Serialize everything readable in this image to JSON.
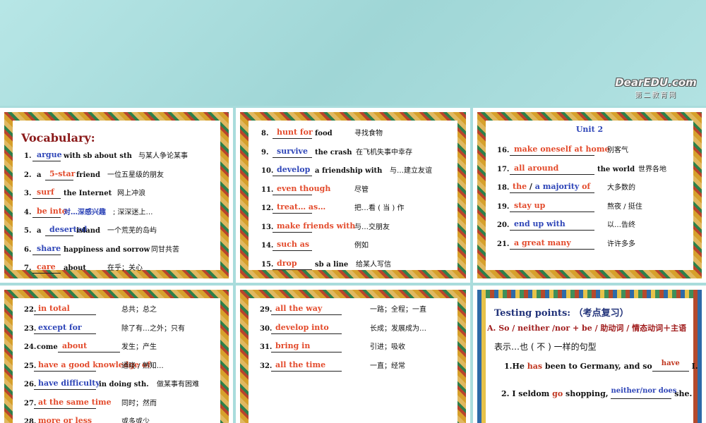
{
  "watermark": {
    "line1": "DearEDU.com",
    "line2": "第二教育网"
  },
  "vocab_title": "Vocabulary:",
  "slide2_unit": "Unit 2",
  "slide1_items": [
    {
      "num": "1.",
      "pre": "",
      "ans": "argue",
      "color": "blue",
      "post": "with sb about sth",
      "cn": "与某人争论某事"
    },
    {
      "num": "2.",
      "pre": "a",
      "ans": "5-star",
      "color": "red",
      "post": "friend",
      "cn": "一位五星级的朋友"
    },
    {
      "num": "3.",
      "pre": "",
      "ans": "surf",
      "color": "red",
      "post": "the Internet",
      "cn": "网上冲浪"
    },
    {
      "num": "4.",
      "pre": "",
      "ans": "be into",
      "color": "red",
      "post": "对…深感兴趣",
      "cn": "; 深深迷上…"
    },
    {
      "num": "5.",
      "pre": "a",
      "ans": "deserted",
      "color": "blue",
      "post": "island",
      "cn": "一个荒芜的岛屿"
    },
    {
      "num": "6.",
      "pre": "",
      "ans": "share",
      "color": "blue",
      "post": "happiness and sorrow",
      "cn": "同甘共苦"
    },
    {
      "num": "7.",
      "pre": "",
      "ans": "care",
      "color": "red",
      "post": "about",
      "cn": "在乎；关心"
    }
  ],
  "slide_mid_items": [
    {
      "num": "8.",
      "ans": "hunt for",
      "color": "red",
      "post": "food",
      "cn": "寻找食物"
    },
    {
      "num": "9.",
      "ans": "survive",
      "color": "blue",
      "post": "the crash",
      "cn": "在飞机失事中幸存"
    },
    {
      "num": "10.",
      "ans": "develop",
      "color": "blue",
      "post": "a friendship with",
      "cn": "与…建立友谊"
    },
    {
      "num": "11.",
      "ans": "even though",
      "color": "red",
      "post": "",
      "cn": "尽管"
    },
    {
      "num": "12.",
      "ans": "treat… as…",
      "color": "red",
      "post": "",
      "cn": "把…看 ( 当 ) 作"
    },
    {
      "num": "13.",
      "ans": "make friends with",
      "color": "red",
      "post": "",
      "cn": "与…交朋友"
    },
    {
      "num": "14.",
      "ans": "such as",
      "color": "red",
      "post": "",
      "cn": "例如"
    },
    {
      "num": "15.",
      "ans": "drop",
      "color": "red",
      "post": "sb a line",
      "cn": "给某人写信"
    }
  ],
  "slide_right_items": [
    {
      "num": "16.",
      "ans": "make oneself at home",
      "color": "red",
      "post": "",
      "cn": "别客气"
    },
    {
      "num": "17.",
      "ans": "all around",
      "color": "red",
      "post": "the world",
      "cn": "世界各地"
    },
    {
      "num": "18.",
      "ans_parts": [
        "the",
        " / ",
        "a majority",
        " of"
      ],
      "color": "mixed",
      "post": "",
      "cn": "大多数的"
    },
    {
      "num": "19.",
      "ans": "stay up",
      "color": "red",
      "post": "",
      "cn": "熬夜 / 挺住"
    },
    {
      "num": "20.",
      "ans": "end up with",
      "color": "blue",
      "post": "",
      "cn": "以…告终"
    },
    {
      "num": "21.",
      "ans": "a great many",
      "color": "red",
      "post": "",
      "cn": "许许多多"
    }
  ],
  "slide_bl_items": [
    {
      "num": "22.",
      "pre": "",
      "ans": "in total",
      "color": "red",
      "post": "",
      "cn": "总共；总之"
    },
    {
      "num": "23.",
      "pre": "",
      "ans": "except for",
      "color": "blue",
      "post": "",
      "cn": "除了有…之外；只有"
    },
    {
      "num": "24.",
      "pre": "come",
      "ans": "about",
      "color": "red",
      "post": "",
      "cn": "发生；产生"
    },
    {
      "num": "25.",
      "pre": "",
      "ans": "have a good knowledge of",
      "color": "red",
      "post": "",
      "cn": "通晓 / 熟知…"
    },
    {
      "num": "26.",
      "pre": "",
      "ans": "have  difficulty",
      "color": "blue",
      "post": "in doing sth.",
      "cn": "做某事有困难"
    },
    {
      "num": "27.",
      "pre": "",
      "ans": "at the same time",
      "color": "red",
      "post": "",
      "cn": "同时；然而"
    },
    {
      "num": "28.",
      "pre": "",
      "ans": "more or less",
      "color": "red",
      "post": "",
      "cn": "或多或少"
    }
  ],
  "slide_bm_items": [
    {
      "num": "29.",
      "ans": "all the way",
      "color": "red",
      "cn": "一路；全程；一直"
    },
    {
      "num": "30.",
      "ans": "develop into",
      "color": "red",
      "cn": "长成；发展成为…"
    },
    {
      "num": "31.",
      "ans": "bring in",
      "color": "red",
      "cn": "引进；吸收"
    },
    {
      "num": "32.",
      "ans": "all the time",
      "color": "red",
      "cn": "一直；经常"
    }
  ],
  "testing": {
    "title": "Testing points:  （考点复习）",
    "rule": "A. So / neither /nor + be / 助动词 / 情态动词＋主语",
    "meaning": "表示…也 ( 不 ) 一样的句型",
    "s1_pre": "1.He ",
    "s1_red": "has",
    "s1_mid": " been to Germany, and so",
    "s1_ans": "have",
    "s1_post": " I.",
    "s2_pre": "2. I seldom ",
    "s2_red": "go",
    "s2_mid": " shopping, ",
    "s2_ans": "neither/nor does",
    "s2_post": " she."
  },
  "colors": {
    "red": "#e34b2c",
    "blue": "#2f46b8",
    "bg": "#a9dcdc"
  }
}
